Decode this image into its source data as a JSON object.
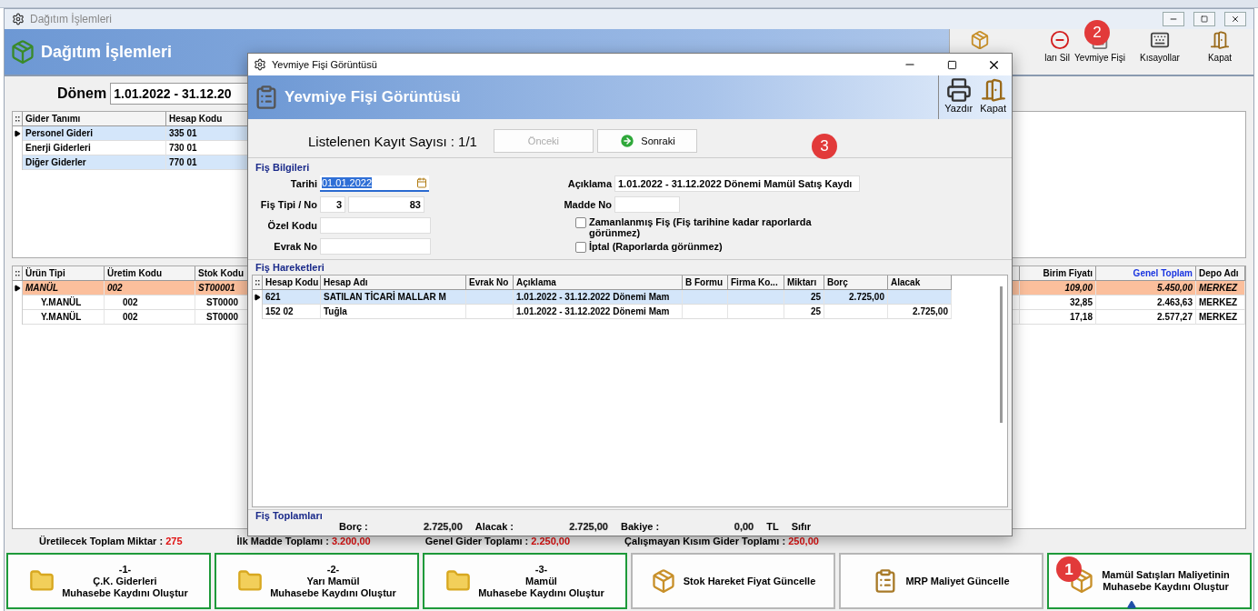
{
  "window": {
    "title": "Dağıtım İşlemleri",
    "header_title": "Dağıtım İşlemleri"
  },
  "toolbar": [
    {
      "kind": "boxes"
    },
    {
      "kind": "delete",
      "label": "ları Sil"
    },
    {
      "kind": "document",
      "label": "Yevmiye Fişi",
      "badge": "2"
    },
    {
      "kind": "keyboard",
      "label": "Kısayollar"
    },
    {
      "kind": "exit",
      "label": "Kapat"
    }
  ],
  "period": {
    "label": "Dönem",
    "value": "1.01.2022 - 31.12.20"
  },
  "expense_table": {
    "columns": [
      "Gider Tanımı",
      "Hesap Kodu"
    ],
    "rows": [
      {
        "selected": true,
        "cells": [
          "Personel Gideri",
          "335 01"
        ]
      },
      {
        "selected": false,
        "cells": [
          "Enerji Giderleri",
          "730 01"
        ]
      },
      {
        "selected": false,
        "cells": [
          "Diğer Giderler",
          "770 01"
        ]
      }
    ]
  },
  "product_table": {
    "columns": [
      {
        "label": "Ürün Tipi",
        "highlighted": false
      },
      {
        "label": "Üretim Kodu",
        "highlighted": false
      },
      {
        "label": "Stok Kodu",
        "highlighted": false
      },
      {
        "label": "Birim Fiyatı",
        "highlighted": false
      },
      {
        "label": "Genel Toplam",
        "highlighted": true
      },
      {
        "label": "Depo Adı",
        "highlighted": false
      }
    ],
    "rows": [
      {
        "kind": "main",
        "selected": true,
        "cells": [
          "MANÜL",
          "002",
          "ST00001",
          "109,00",
          "5.450,00",
          "MERKEZ"
        ]
      },
      {
        "kind": "sub",
        "selected": false,
        "cells": [
          "Y.MANÜL",
          "002",
          "ST0000",
          "32,85",
          "2.463,63",
          "MERKEZ"
        ]
      },
      {
        "kind": "sub",
        "selected": false,
        "cells": [
          "Y.MANÜL",
          "002",
          "ST0000",
          "17,18",
          "2.577,27",
          "MERKEZ"
        ]
      }
    ]
  },
  "totals": [
    {
      "label": "Üretilecek Toplam Miktar :",
      "value": "275"
    },
    {
      "label": "İlk Madde Toplamı :",
      "value": "3.200,00"
    },
    {
      "label": "Genel Gider Toplamı :",
      "value": "2.250,00"
    },
    {
      "label": "Çalışmayan Kısım Gider Toplamı :",
      "value": "250,00"
    }
  ],
  "actions": [
    {
      "kind": "folder",
      "highlighted": true,
      "lines": [
        "-1-",
        "Ç.K. Giderleri",
        "Muhasebe Kaydını Oluştur"
      ]
    },
    {
      "kind": "folder",
      "highlighted": true,
      "lines": [
        "-2-",
        "Yarı Mamül",
        "Muhasebe Kaydını Oluştur"
      ]
    },
    {
      "kind": "folder",
      "highlighted": true,
      "lines": [
        "-3-",
        "Mamül",
        "Muhasebe Kaydını Oluştur"
      ]
    },
    {
      "kind": "boxes",
      "highlighted": false,
      "lines": [
        "Stok Hareket Fiyat Güncelle"
      ]
    },
    {
      "kind": "clipboard",
      "highlighted": false,
      "lines": [
        "MRP Maliyet Güncelle"
      ]
    },
    {
      "kind": "boxes",
      "highlighted": true,
      "badge": "1",
      "lines": [
        "Mamül Satışları Maliyetinin",
        "Muhasebe Kaydını Oluştur"
      ]
    }
  ],
  "dialog": {
    "title": "Yevmiye Fişi Görüntüsü",
    "header_title": "Yevmiye Fişi Görüntüsü",
    "tools": [
      {
        "kind": "printer",
        "label": "Yazdır"
      },
      {
        "kind": "exit",
        "label": "Kapat"
      }
    ],
    "record_count": "Listelenen Kayıt Sayısı : 1/1",
    "nav": [
      {
        "label": "Önceki",
        "disabled": true
      },
      {
        "label": "Sonraki",
        "disabled": false
      }
    ],
    "badge": "3",
    "info": {
      "title": "Fiş Bilgileri",
      "date_label": "Tarihi",
      "date": "01.01.2022",
      "type_label": "Fiş Tipi / No",
      "type": "3",
      "number": "83",
      "special_label": "Özel Kodu",
      "doc_label": "Evrak No",
      "desc_label": "Açıklama",
      "desc": "1.01.2022 - 31.12.2022 Dönemi Mamül Satış Kaydı",
      "item_label": "Madde No",
      "checks": [
        {
          "label": "Zamanlanmış Fiş (Fiş tarihine kadar raporlarda görünmez)",
          "checked": false
        },
        {
          "label": "İptal (Raporlarda görünmez)",
          "checked": false
        }
      ]
    },
    "movements": {
      "title": "Fiş Hareketleri",
      "columns": [
        "Hesap Kodu",
        "Hesap Adı",
        "Evrak No",
        "Açıklama",
        "B Formu",
        "Firma Ko...",
        "Miktarı",
        "Borç",
        "Alacak"
      ],
      "rows": [
        {
          "selected": true,
          "cells": [
            "621",
            "SATILAN TİCARİ MALLAR M",
            null,
            "1.01.2022 - 31.12.2022 Dönemi Mam",
            null,
            null,
            "25",
            "2.725,00",
            null
          ]
        },
        {
          "selected": false,
          "cells": [
            "152 02",
            "Tuğla",
            null,
            "1.01.2022 - 31.12.2022 Dönemi Mam",
            null,
            null,
            "25",
            null,
            "2.725,00"
          ]
        }
      ]
    },
    "totals": {
      "title": "Fiş Toplamları",
      "items": [
        {
          "label": "Borç :",
          "value": "2.725,00"
        },
        {
          "label": "Alacak :",
          "value": "2.725,00"
        },
        {
          "label": "Bakiye :",
          "value": "0,00"
        }
      ],
      "currency": "TL",
      "status": "Sıfır"
    }
  }
}
